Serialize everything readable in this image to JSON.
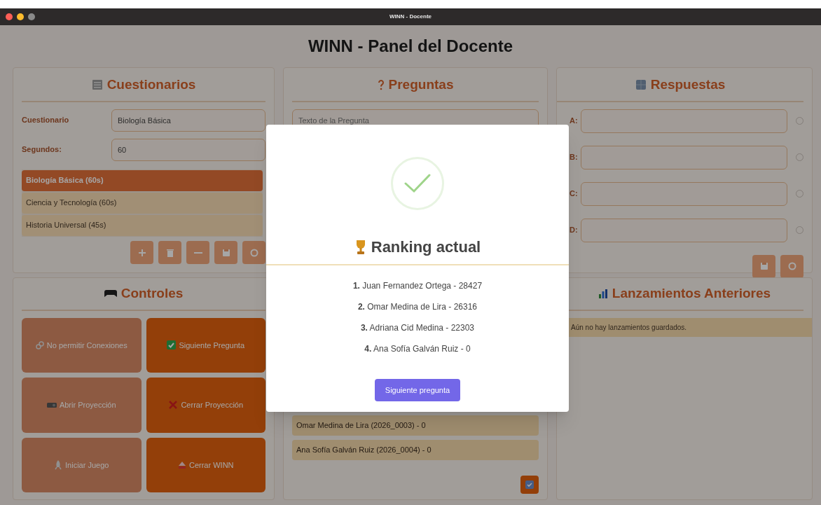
{
  "window": {
    "title": "WINN - Docente"
  },
  "header": "WINN - Panel del Docente",
  "cuestionarios": {
    "title": "Cuestionarios",
    "fields": [
      {
        "label": "Cuestionario",
        "value": "Biología Básica"
      },
      {
        "label": "Segundos:",
        "value": "60"
      }
    ],
    "items": [
      {
        "label": "Biología Básica (60s)",
        "selected": true
      },
      {
        "label": "Ciencia y Tecnología (60s)",
        "selected": false
      },
      {
        "label": "Historia Universal (45s)",
        "selected": false
      }
    ]
  },
  "preguntas": {
    "title": "Preguntas",
    "question_placeholder": "Texto de la Pregunta",
    "players": [
      "Omar Medina de Lira (2026_0003) - 0",
      "Ana Sofía Galván Ruiz (2026_0004) - 0"
    ]
  },
  "respuestas": {
    "title": "Respuestas",
    "answers": [
      {
        "label": "A:",
        "selected": false
      },
      {
        "label": "B:",
        "selected": false
      },
      {
        "label": "C:",
        "selected": false
      },
      {
        "label": "D:",
        "selected": false
      }
    ]
  },
  "controles": {
    "title": "Controles",
    "buttons": [
      {
        "kind": "connections",
        "label": "No permitir Conexiones",
        "disabled": true
      },
      {
        "kind": "next",
        "label": "Siguiente Pregunta",
        "disabled": false
      },
      {
        "kind": "open",
        "label": "Abrir Proyección",
        "disabled": true
      },
      {
        "kind": "close",
        "label": "Cerrar Proyección",
        "disabled": false
      },
      {
        "kind": "start",
        "label": "Iniciar Juego",
        "disabled": true
      },
      {
        "kind": "exit",
        "label": "Cerrar WINN",
        "disabled": false
      }
    ]
  },
  "lanzamientos": {
    "title": "Lanzamientos Anteriores",
    "empty_message": "Aún no hay lanzamientos guardados."
  },
  "modal": {
    "title": "Ranking actual",
    "ranking": [
      "**1.** Juan Fernandez Ortega - 28427",
      "**2.** Omar Medina de Lira - 26316",
      "**3.** Adriana Cid Medina - 22303",
      "**4.** Ana Sofía Galván Ruiz - 0"
    ],
    "button": "Siguiente pregunta"
  }
}
